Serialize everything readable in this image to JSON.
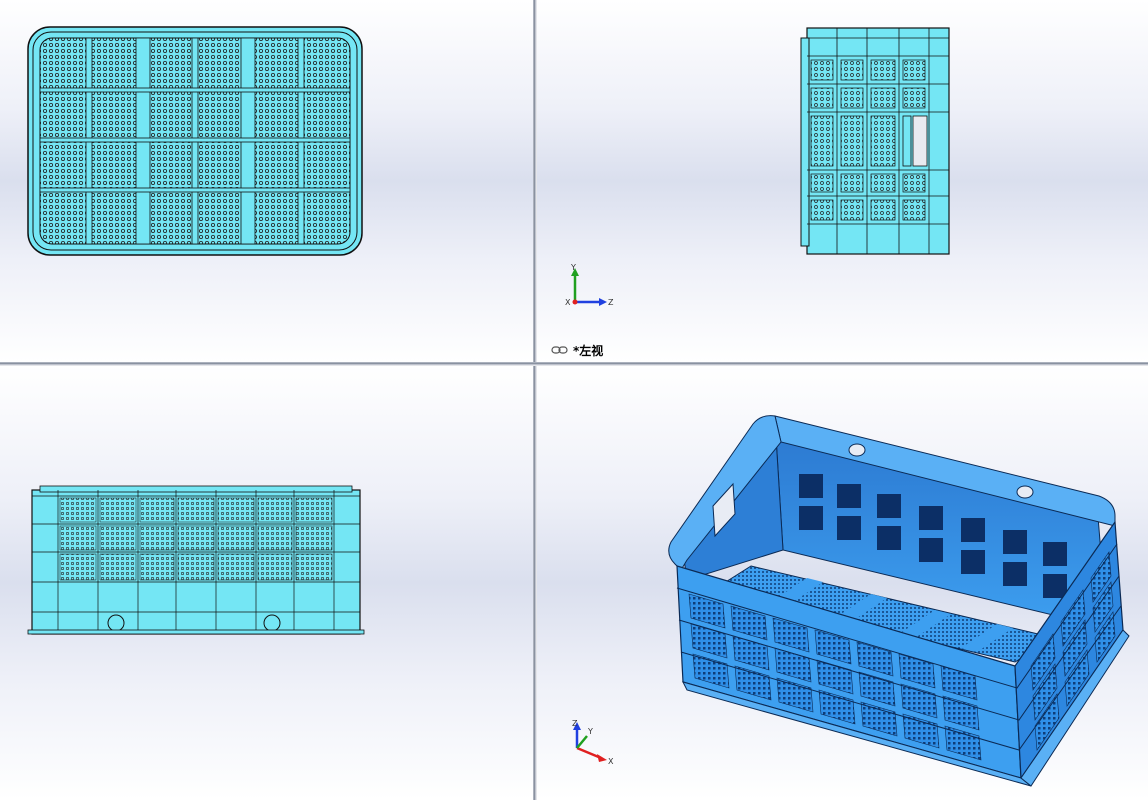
{
  "viewports": {
    "top_left": {
      "name": "top-view"
    },
    "top_right": {
      "name": "left-view",
      "label": "*左视",
      "link_icon": "link-icon",
      "triad": {
        "up": "Y",
        "right": "Z",
        "origin": "X"
      }
    },
    "bottom_left": {
      "name": "front-view"
    },
    "bottom_right": {
      "name": "isometric-view",
      "triad": {
        "up": "Z",
        "right": "X",
        "origin": "Y"
      }
    }
  },
  "colors": {
    "body": "#74e6f4",
    "outline": "#111111",
    "iso_body": "#3d9ff0",
    "iso_inner": "#2d7fd6",
    "accent_red": "#e02020",
    "accent_green": "#20a020",
    "accent_blue": "#2040e0"
  }
}
